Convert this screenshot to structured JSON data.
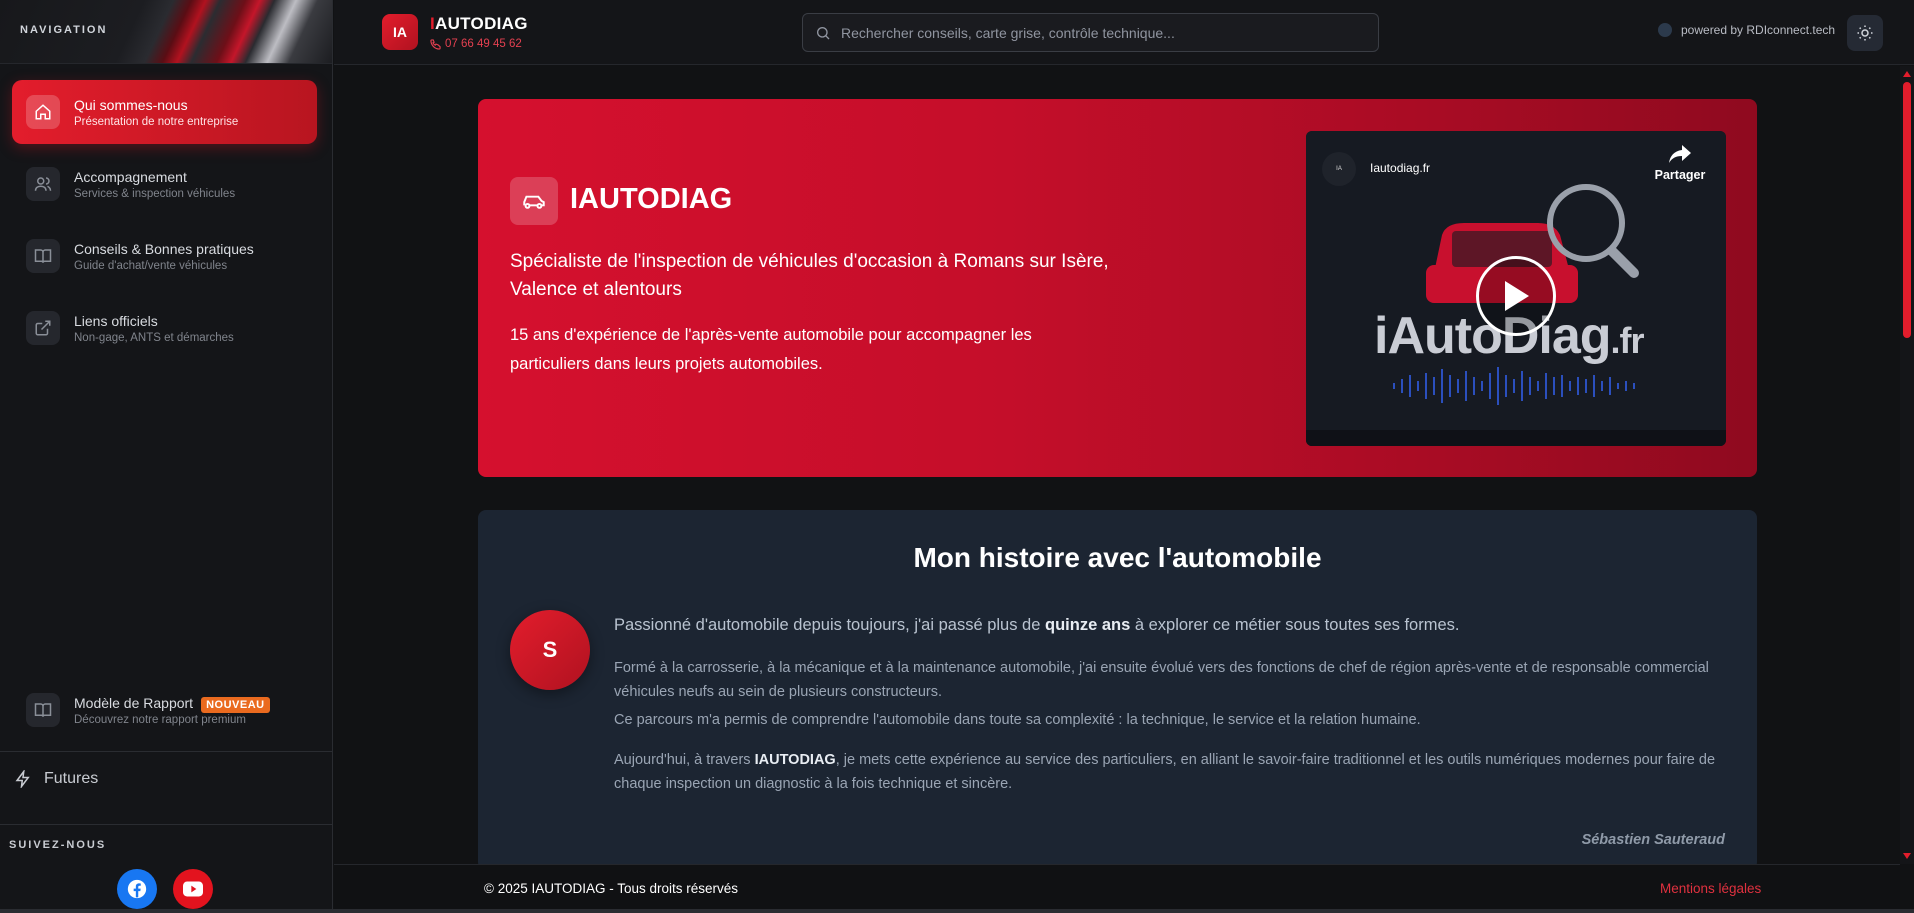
{
  "sidebar": {
    "header": "NAVIGATION",
    "items": [
      {
        "label": "Qui sommes-nous",
        "sub": "Présentation de notre entreprise",
        "icon": "home-icon"
      },
      {
        "label": "Accompagnement",
        "sub": "Services & inspection véhicules",
        "icon": "users-icon"
      },
      {
        "label": "Conseils & Bonnes pratiques",
        "sub": "Guide d'achat/vente véhicules",
        "icon": "book-icon"
      },
      {
        "label": "Liens officiels",
        "sub": "Non-gage, ANTS et démarches",
        "icon": "external-link-icon"
      }
    ],
    "report": {
      "label": "Modèle de Rapport",
      "badge": "NOUVEAU",
      "sub": "Découvrez notre rapport premium",
      "icon": "book-icon"
    },
    "futures": "Futures",
    "follow": "SUIVEZ-NOUS",
    "social": [
      {
        "name": "facebook-icon",
        "color": "#1877f2"
      },
      {
        "name": "youtube-icon",
        "color": "#e3131e"
      }
    ]
  },
  "header": {
    "logo": "IA",
    "brand_i": "I",
    "brand_rest": "AUTODIAG",
    "phone": "07 66 49 45 62",
    "search_placeholder": "Rechercher conseils, carte grise, contrôle technique...",
    "powered": "powered by RDIconnect.tech"
  },
  "hero": {
    "title": "IAUTODIAG",
    "subtitle": "Spécialiste de l'inspection de véhicules d'occasion à Romans sur Isère, Valence et alentours",
    "description": "15 ans d'expérience de l'après-vente automobile pour accompagner les particuliers dans leurs projets automobiles.",
    "video": {
      "channel": "Iautodiag.fr",
      "share": "Partager",
      "big_text": "iAutoDiag",
      "big_suffix": ".fr"
    }
  },
  "story": {
    "title": "Mon histoire avec l'automobile",
    "avatar": "S",
    "p1_a": "Passionné d'automobile depuis toujours, j'ai passé plus de ",
    "p1_b": "quinze ans",
    "p1_c": " à explorer ce métier sous toutes ses formes.",
    "p2": "Formé à la carrosserie, à la mécanique et à la maintenance automobile, j'ai ensuite évolué vers des fonctions de chef de région après-vente et de responsable commercial véhicules neufs au sein de plusieurs constructeurs.",
    "p3": "Ce parcours m'a permis de comprendre l'automobile dans toute sa complexité : la technique, le service et la relation humaine.",
    "p4_a": "Aujourd'hui, à travers ",
    "p4_b": "IAUTODIAG",
    "p4_c": ", je mets cette expérience au service des particuliers, en alliant le savoir-faire traditionnel et les outils numériques modernes pour faire de chaque inspection un diagnostic à la fois technique et sincère.",
    "signature": "Sébastien Sauteraud"
  },
  "footer": {
    "copyright": "© 2025 IAUTODIAG - Tous droits réservés",
    "legal": "Mentions légales"
  },
  "colors": {
    "accent": "#e31d2c",
    "card": "#1c2532",
    "background": "#111214"
  }
}
